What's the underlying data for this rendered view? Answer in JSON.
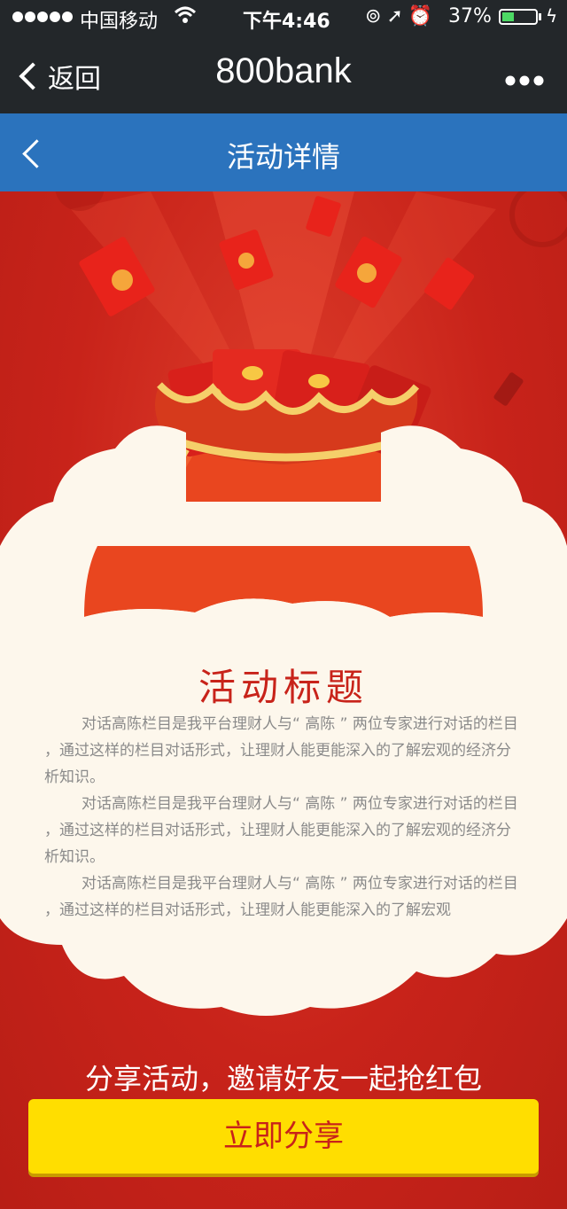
{
  "status": {
    "carrier": "中国移动",
    "time": "下午4:46",
    "battery_pct": "37%",
    "battery_level": 0.37
  },
  "nav": {
    "back_label": "返回",
    "title": "800bank",
    "more_label": "•••"
  },
  "header": {
    "title": "活动详情"
  },
  "activity": {
    "title": "活动标题",
    "paragraphs": [
      "对话高陈栏目是我平台理财人与“ 高陈 ” 两位专家进行对话的栏目 ，通过这样的栏目对话形式，让理财人能更能深入的了解宏观的经济分析知识。",
      "对话高陈栏目是我平台理财人与“ 高陈 ” 两位专家进行对话的栏目 ，通过这样的栏目对话形式，让理财人能更能深入的了解宏观的经济分析知识。",
      "对话高陈栏目是我平台理财人与“ 高陈 ” 两位专家进行对话的栏目 ，通过这样的栏目对话形式，让理财人能更能深入的了解宏观"
    ]
  },
  "share": {
    "caption": "分享活动，邀请好友一起抢红包",
    "button_label": "立即分享"
  },
  "colors": {
    "nav_bg": "#23272a",
    "header_bg": "#2b73bd",
    "page_red": "#c8231a",
    "button_yellow": "#ffde00",
    "cloud": "#fdf7ec"
  }
}
